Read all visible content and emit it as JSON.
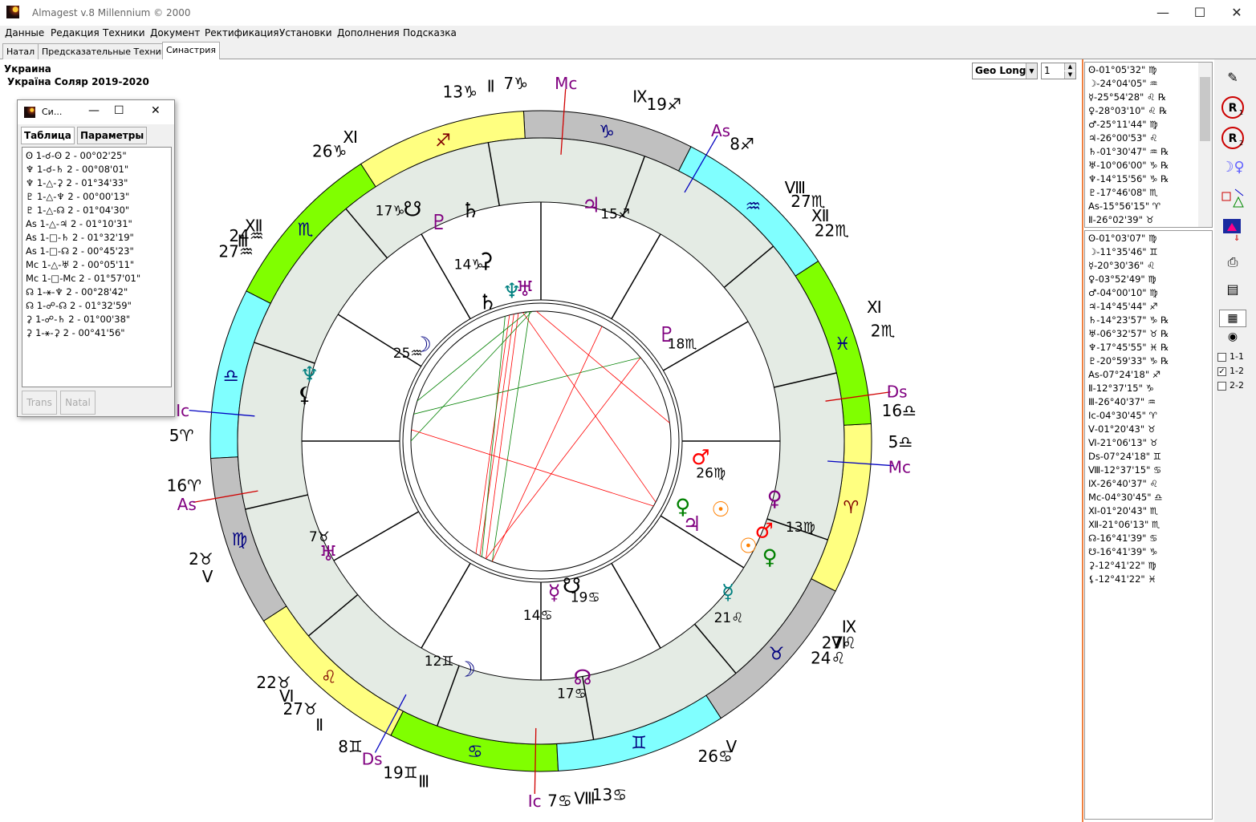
{
  "window": {
    "title": "Almagest v.8 Millennium © 2000",
    "minimize": "—",
    "maximize": "☐",
    "close": "✕"
  },
  "menu": [
    "Данные",
    "Редакция",
    "Техники",
    "Документ",
    "Ректификация",
    "Установки",
    "Дополнения",
    "Подсказка"
  ],
  "tabs": [
    {
      "label": "Натал"
    },
    {
      "label": "Предсказательные Техники"
    },
    {
      "label": "Синастрия"
    }
  ],
  "chart_header": {
    "line1": "Украина",
    "line2": "Україна Соляр 2019-2020"
  },
  "geo_select": {
    "value": "Geo Long",
    "spin_value": "1"
  },
  "aspect_window": {
    "title": "Си...",
    "tab_table": "Таблица",
    "tab_params": "Параметры",
    "rows": [
      "ʘ 1-☌-ʘ 2 - 00°02'25\"",
      "♆ 1-☌-♄ 2 - 00°08'01\"",
      "♆ 1-△-⚳ 2 - 01°34'33\"",
      "♇ 1-△-♆ 2 - 00°00'13\"",
      "♇ 1-△-☊ 2 - 01°04'30\"",
      "As 1-△-♃ 2 - 01°10'31\"",
      "As 1-□-♄ 2 - 01°32'19\"",
      "As 1-□-☊ 2 - 00°45'23\"",
      "Mc 1-△-♅ 2 - 00°05'11\"",
      "Mc 1-□-Mc 2 - 01°57'01\"",
      "☊ 1-⚹-♆ 2 - 00°28'42\"",
      "☊ 1-☍-☊ 2 - 01°32'59\"",
      "⚳ 1-☍-♄ 2 - 01°00'38\"",
      "⚳ 1-⚹-⚳ 2 - 00°41'56\""
    ],
    "btn_trans": "Trans",
    "btn_natal": "Natal"
  },
  "list1": [
    "ʘ-01°05'32\" ♍",
    "☽-24°04'05\" ♒",
    "☿-25°54'28\" ♌ ℞",
    "♀-28°03'10\" ♌ ℞",
    "♂-25°11'44\" ♍",
    "♃-26°00'53\" ♌",
    "♄-01°30'47\" ♒ ℞",
    "♅-10°06'00\" ♑ ℞",
    "♆-14°15'56\" ♑ ℞",
    "♇-17°46'08\" ♏",
    "As-15°56'15\" ♈",
    "Ⅱ-26°02'39\" ♉"
  ],
  "list2": [
    "ʘ-01°03'07\" ♍",
    "☽-11°35'46\" ♊",
    "☿-20°30'36\" ♌",
    "♀-03°52'49\" ♍",
    "♂-04°00'10\" ♍",
    "♃-14°45'44\" ♐",
    "♄-14°23'57\" ♑ ℞",
    "♅-06°32'57\" ♉ ℞",
    "♆-17°45'55\" ♓ ℞",
    "♇-20°59'33\" ♑ ℞",
    "As-07°24'18\" ♐",
    "Ⅱ-12°37'15\" ♑",
    "Ⅲ-26°40'37\" ♒",
    "Ic-04°30'45\" ♈",
    "Ⅴ-01°20'43\" ♉",
    "Ⅵ-21°06'13\" ♉",
    "Ds-07°24'18\" ♊",
    "Ⅷ-12°37'15\" ♋",
    "Ⅸ-26°40'37\" ♌",
    "Mc-04°30'45\" ♎",
    "Ⅺ-01°20'43\" ♏",
    "Ⅻ-21°06'13\" ♏",
    "☊-16°41'39\" ♋",
    "☋-16°41'39\" ♑",
    "⚳-12°41'22\" ♍",
    "⚸-12°41'22\" ♓"
  ],
  "toolbar_checks": {
    "c11": "1-1",
    "c12": "1-2",
    "c22": "2-2",
    "checked_mark": "✓"
  },
  "chart_data": {
    "type": "other",
    "zodiac_ring": [
      {
        "sign": "♑",
        "color": "#c0c0c0"
      },
      {
        "sign": "♐",
        "color": "#ffff80"
      },
      {
        "sign": "♏",
        "color": "#80ff00"
      },
      {
        "sign": "♎",
        "color": "#80ffff"
      },
      {
        "sign": "♍",
        "color": "#c0c0c0"
      },
      {
        "sign": "♌",
        "color": "#ffff80"
      },
      {
        "sign": "♋",
        "color": "#80ff00"
      },
      {
        "sign": "♊",
        "color": "#80ffff"
      },
      {
        "sign": "♉",
        "color": "#c0c0c0"
      },
      {
        "sign": "♈",
        "color": "#ffff80"
      },
      {
        "sign": "♓",
        "color": "#80ff00"
      },
      {
        "sign": "♒",
        "color": "#80ffff"
      }
    ],
    "outer_labels": [
      {
        "text": "13♑",
        "angle": 103
      },
      {
        "text": "Ⅱ",
        "angle": 98
      },
      {
        "text": "7♑",
        "angle": 94
      },
      {
        "text": "Mc",
        "angle": 86,
        "color": "#800080"
      },
      {
        "text": "Ⅸ",
        "angle": 74
      },
      {
        "text": "19♐",
        "angle": 70
      },
      {
        "text": "As",
        "angle": 60,
        "color": "#800080"
      },
      {
        "text": "8♐",
        "angle": 56
      },
      {
        "text": "Ⅷ",
        "angle": 45
      },
      {
        "text": "27♏",
        "angle": 42
      },
      {
        "text": "Ⅻ",
        "angle": 39
      },
      {
        "text": "22♏",
        "angle": 36
      },
      {
        "text": "Ⅺ",
        "angle": 22
      },
      {
        "text": "2♏",
        "angle": 18
      },
      {
        "text": "Ds",
        "angle": 8,
        "color": "#800080"
      },
      {
        "text": "16♎",
        "angle": 5
      },
      {
        "text": "Mc",
        "angle": -4,
        "color": "#800080"
      },
      {
        "text": "5♎",
        "angle": 0
      },
      {
        "text": "Ⅵ",
        "angle": -34
      },
      {
        "text": "Ⅸ",
        "angle": -31
      },
      {
        "text": "24♌",
        "angle": -37
      },
      {
        "text": "27♌",
        "angle": -34
      },
      {
        "text": "Ⅴ",
        "angle": -58
      },
      {
        "text": "26♋",
        "angle": -61
      },
      {
        "text": "Ⅷ",
        "angle": -83
      },
      {
        "text": "13♋",
        "angle": -79
      },
      {
        "text": "7♋",
        "angle": -87
      },
      {
        "text": "Ic",
        "angle": -91,
        "color": "#800080"
      },
      {
        "text": "Ⅲ",
        "angle": -109
      },
      {
        "text": "19♊",
        "angle": -113
      },
      {
        "text": "Ds",
        "angle": -118,
        "color": "#800080"
      },
      {
        "text": "8♊",
        "angle": -122
      },
      {
        "text": "Ⅵ",
        "angle": -135
      },
      {
        "text": "Ⅱ",
        "angle": -128
      },
      {
        "text": "22♉",
        "angle": -138
      },
      {
        "text": "27♉",
        "angle": -132
      },
      {
        "text": "Ⅴ",
        "angle": -158
      },
      {
        "text": "2♉",
        "angle": -161
      },
      {
        "text": "As",
        "angle": -170,
        "color": "#800080"
      },
      {
        "text": "16♈",
        "angle": -173
      },
      {
        "text": "Ic",
        "angle": 175,
        "color": "#800080"
      },
      {
        "text": "5♈",
        "angle": 179
      },
      {
        "text": "Ⅲ",
        "angle": 146
      },
      {
        "text": "Ⅻ",
        "angle": 143
      },
      {
        "text": "27♒",
        "angle": 148
      },
      {
        "text": "24♒",
        "angle": 145
      },
      {
        "text": "Ⅺ",
        "angle": 122
      },
      {
        "text": "26♑",
        "angle": 126
      }
    ],
    "inner_planets": [
      {
        "glyph": "☋",
        "angle": 119,
        "radius": 330,
        "color": "#000000"
      },
      {
        "glyph": "17♑",
        "angle": 123,
        "radius": 345,
        "color": "#000000"
      },
      {
        "glyph": "♇",
        "angle": 115,
        "radius": 300,
        "color": "#800080"
      },
      {
        "glyph": "♄",
        "angle": 107,
        "radius": 300,
        "color": "#000000"
      },
      {
        "glyph": "♃",
        "angle": 78,
        "radius": 300,
        "color": "#800080"
      },
      {
        "glyph": "15♐",
        "angle": 72,
        "radius": 300,
        "color": "#000000"
      },
      {
        "glyph": "♇",
        "angle": 40,
        "radius": 205,
        "color": "#800080"
      },
      {
        "glyph": "18♏",
        "angle": 35,
        "radius": 215,
        "color": "#000000"
      },
      {
        "glyph": "♂",
        "angle": -6,
        "radius": 200,
        "color": "#ff0000"
      },
      {
        "glyph": "26♍",
        "angle": -10,
        "radius": 215,
        "color": "#000000"
      },
      {
        "glyph": "♀",
        "angle": -14,
        "radius": 300,
        "color": "#800080"
      },
      {
        "glyph": "13♍",
        "angle": -18,
        "radius": 340,
        "color": "#000000"
      },
      {
        "glyph": "♂",
        "angle": -22,
        "radius": 300,
        "color": "#ff0000"
      },
      {
        "glyph": "☉",
        "angle": -27,
        "radius": 290,
        "color": "#ff8000"
      },
      {
        "glyph": "♀",
        "angle": -27,
        "radius": 320,
        "color": "#008000"
      },
      {
        "glyph": "☿",
        "angle": -39,
        "radius": 300,
        "color": "#008080"
      },
      {
        "glyph": "21♌",
        "angle": -43,
        "radius": 320,
        "color": "#000000"
      },
      {
        "glyph": "☊",
        "angle": -80,
        "radius": 300,
        "color": "#800080"
      },
      {
        "glyph": "17♋",
        "angle": -83,
        "radius": 315,
        "color": "#000000"
      },
      {
        "glyph": "☽",
        "angle": -108,
        "radius": 300,
        "color": "#000080"
      },
      {
        "glyph": "12♊",
        "angle": -115,
        "radius": 300,
        "color": "#000000"
      },
      {
        "glyph": "♅",
        "angle": -152,
        "radius": 300,
        "color": "#800080"
      },
      {
        "glyph": "7♉",
        "angle": -157,
        "radius": 300,
        "color": "#000000"
      },
      {
        "glyph": "♆",
        "angle": 164,
        "radius": 300,
        "color": "#008080"
      },
      {
        "glyph": "⚸",
        "angle": 169,
        "radius": 300,
        "color": "#000000"
      },
      {
        "glyph": "☽",
        "angle": 141,
        "radius": 190,
        "color": "#000080"
      },
      {
        "glyph": "25♒",
        "angle": 146,
        "radius": 200,
        "color": "#000000"
      },
      {
        "glyph": "⚳",
        "angle": 107,
        "radius": 235,
        "color": "#000000"
      },
      {
        "glyph": "14♑",
        "angle": 112,
        "radius": 240,
        "color": "#000000"
      },
      {
        "glyph": "♆",
        "angle": 101,
        "radius": 190,
        "color": "#008080"
      },
      {
        "glyph": "♅",
        "angle": 96,
        "radius": 190,
        "color": "#800080"
      },
      {
        "glyph": "♄",
        "angle": 111,
        "radius": 185,
        "color": "#000000"
      },
      {
        "glyph": "☿",
        "angle": -85,
        "radius": 190,
        "color": "#800080"
      },
      {
        "glyph": "14♋",
        "angle": -91,
        "radius": 215,
        "color": "#000000"
      },
      {
        "glyph": "☋",
        "angle": -78,
        "radius": 185,
        "color": "#000000"
      },
      {
        "glyph": "19♋",
        "angle": -74,
        "radius": 200,
        "color": "#000000"
      },
      {
        "glyph": "☉",
        "angle": -21,
        "radius": 240,
        "color": "#ff8000"
      },
      {
        "glyph": "♀",
        "angle": -25,
        "radius": 195,
        "color": "#008000"
      },
      {
        "glyph": "♃",
        "angle": -29,
        "radius": 215,
        "color": "#800080"
      }
    ],
    "aspect_lines": [
      {
        "a1": 104,
        "a2": -120,
        "color": "#ff0000"
      },
      {
        "a1": 102,
        "a2": -118,
        "color": "#ff0000"
      },
      {
        "a1": 100,
        "a2": -115,
        "color": "#ff0000"
      },
      {
        "a1": 98,
        "a2": -28,
        "color": "#ff0000"
      },
      {
        "a1": 106,
        "a2": -117,
        "color": "#008000"
      },
      {
        "a1": 95,
        "a2": -112,
        "color": "#008000"
      },
      {
        "a1": 96,
        "a2": 162,
        "color": "#008000"
      },
      {
        "a1": 94,
        "a2": 180,
        "color": "#008000"
      },
      {
        "a1": 40,
        "a2": 168,
        "color": "#008000"
      },
      {
        "a1": 40,
        "a2": -115,
        "color": "#ff0000"
      },
      {
        "a1": -30,
        "a2": 175,
        "color": "#ff0000"
      },
      {
        "a1": 62,
        "a2": -112,
        "color": "#ff0000"
      },
      {
        "a1": 92,
        "a2": 8,
        "color": "#ff0000"
      }
    ]
  }
}
